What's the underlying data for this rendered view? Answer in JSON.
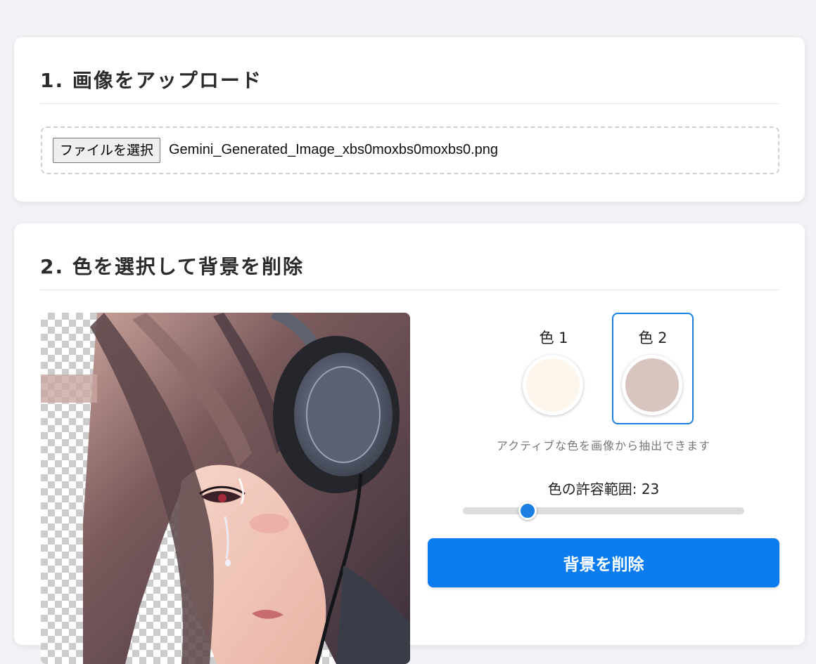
{
  "upload_section": {
    "title": "1. 画像をアップロード",
    "file_button_label": "ファイルを選択",
    "file_name": "Gemini_Generated_Image_xbs0moxbs0moxbs0.png"
  },
  "remove_section": {
    "title": "2. 色を選択して背景を削除",
    "colors": [
      {
        "label": "色 1",
        "value": "#fdf6ec",
        "active": false
      },
      {
        "label": "色 2",
        "value": "#d8c5c0",
        "active": true
      }
    ],
    "hint": "アクティブな色を画像から抽出できます",
    "tolerance": {
      "label": "色の許容範囲: 23",
      "value": 23,
      "max": 100
    },
    "remove_button_label": "背景を削除"
  },
  "colors": {
    "accent": "#0a7cf0",
    "page_background": "#f0f2f5"
  }
}
